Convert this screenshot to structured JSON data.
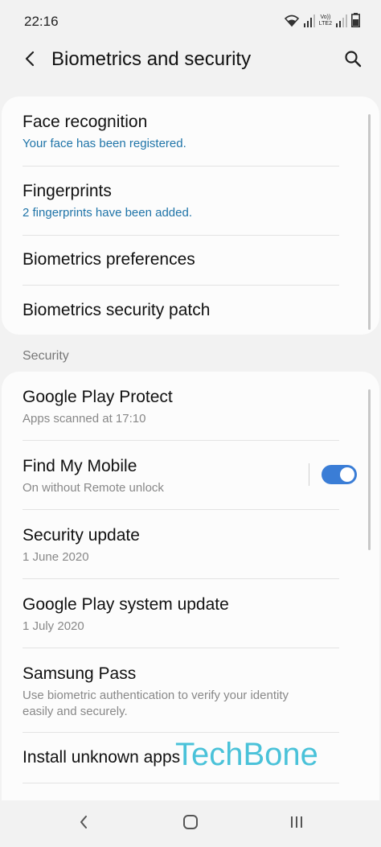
{
  "status": {
    "time": "22:16",
    "lte_label": "Vo))\nLTE2",
    "wifi_icon": "wifi-icon",
    "signal_icon": "signal-icon",
    "battery_icon": "battery-icon"
  },
  "appbar": {
    "title": "Biometrics and security",
    "back_icon": "back-arrow-icon",
    "search_icon": "search-icon"
  },
  "biometrics": {
    "items": [
      {
        "title": "Face recognition",
        "subtitle": "Your face has been registered."
      },
      {
        "title": "Fingerprints",
        "subtitle": "2 fingerprints have been added."
      },
      {
        "title": "Biometrics preferences"
      },
      {
        "title": "Biometrics security patch"
      }
    ]
  },
  "security": {
    "header": "Security",
    "items": [
      {
        "title": "Google Play Protect",
        "subtitle": "Apps scanned at 17:10"
      },
      {
        "title": "Find My Mobile",
        "subtitle": "On without Remote unlock",
        "toggle_on": true
      },
      {
        "title": "Security update",
        "subtitle": "1 June 2020"
      },
      {
        "title": "Google Play system update",
        "subtitle": "1 July 2020"
      },
      {
        "title": "Samsung Pass",
        "subtitle_line1": "Use biometric authentication to verify your identity",
        "subtitle_line2": "easily and securely."
      },
      {
        "title": "Install unknown apps"
      }
    ]
  },
  "watermark": "TechBone",
  "navbar": {
    "back_icon": "nav-back-icon",
    "home_icon": "nav-home-icon",
    "recents_icon": "nav-recents-icon"
  },
  "colors": {
    "background": "#f2f2f2",
    "card": "#fcfcfc",
    "accent_blue": "#1f74a8",
    "toggle_blue": "#3a7dd6",
    "watermark": "#2bb8d3"
  }
}
